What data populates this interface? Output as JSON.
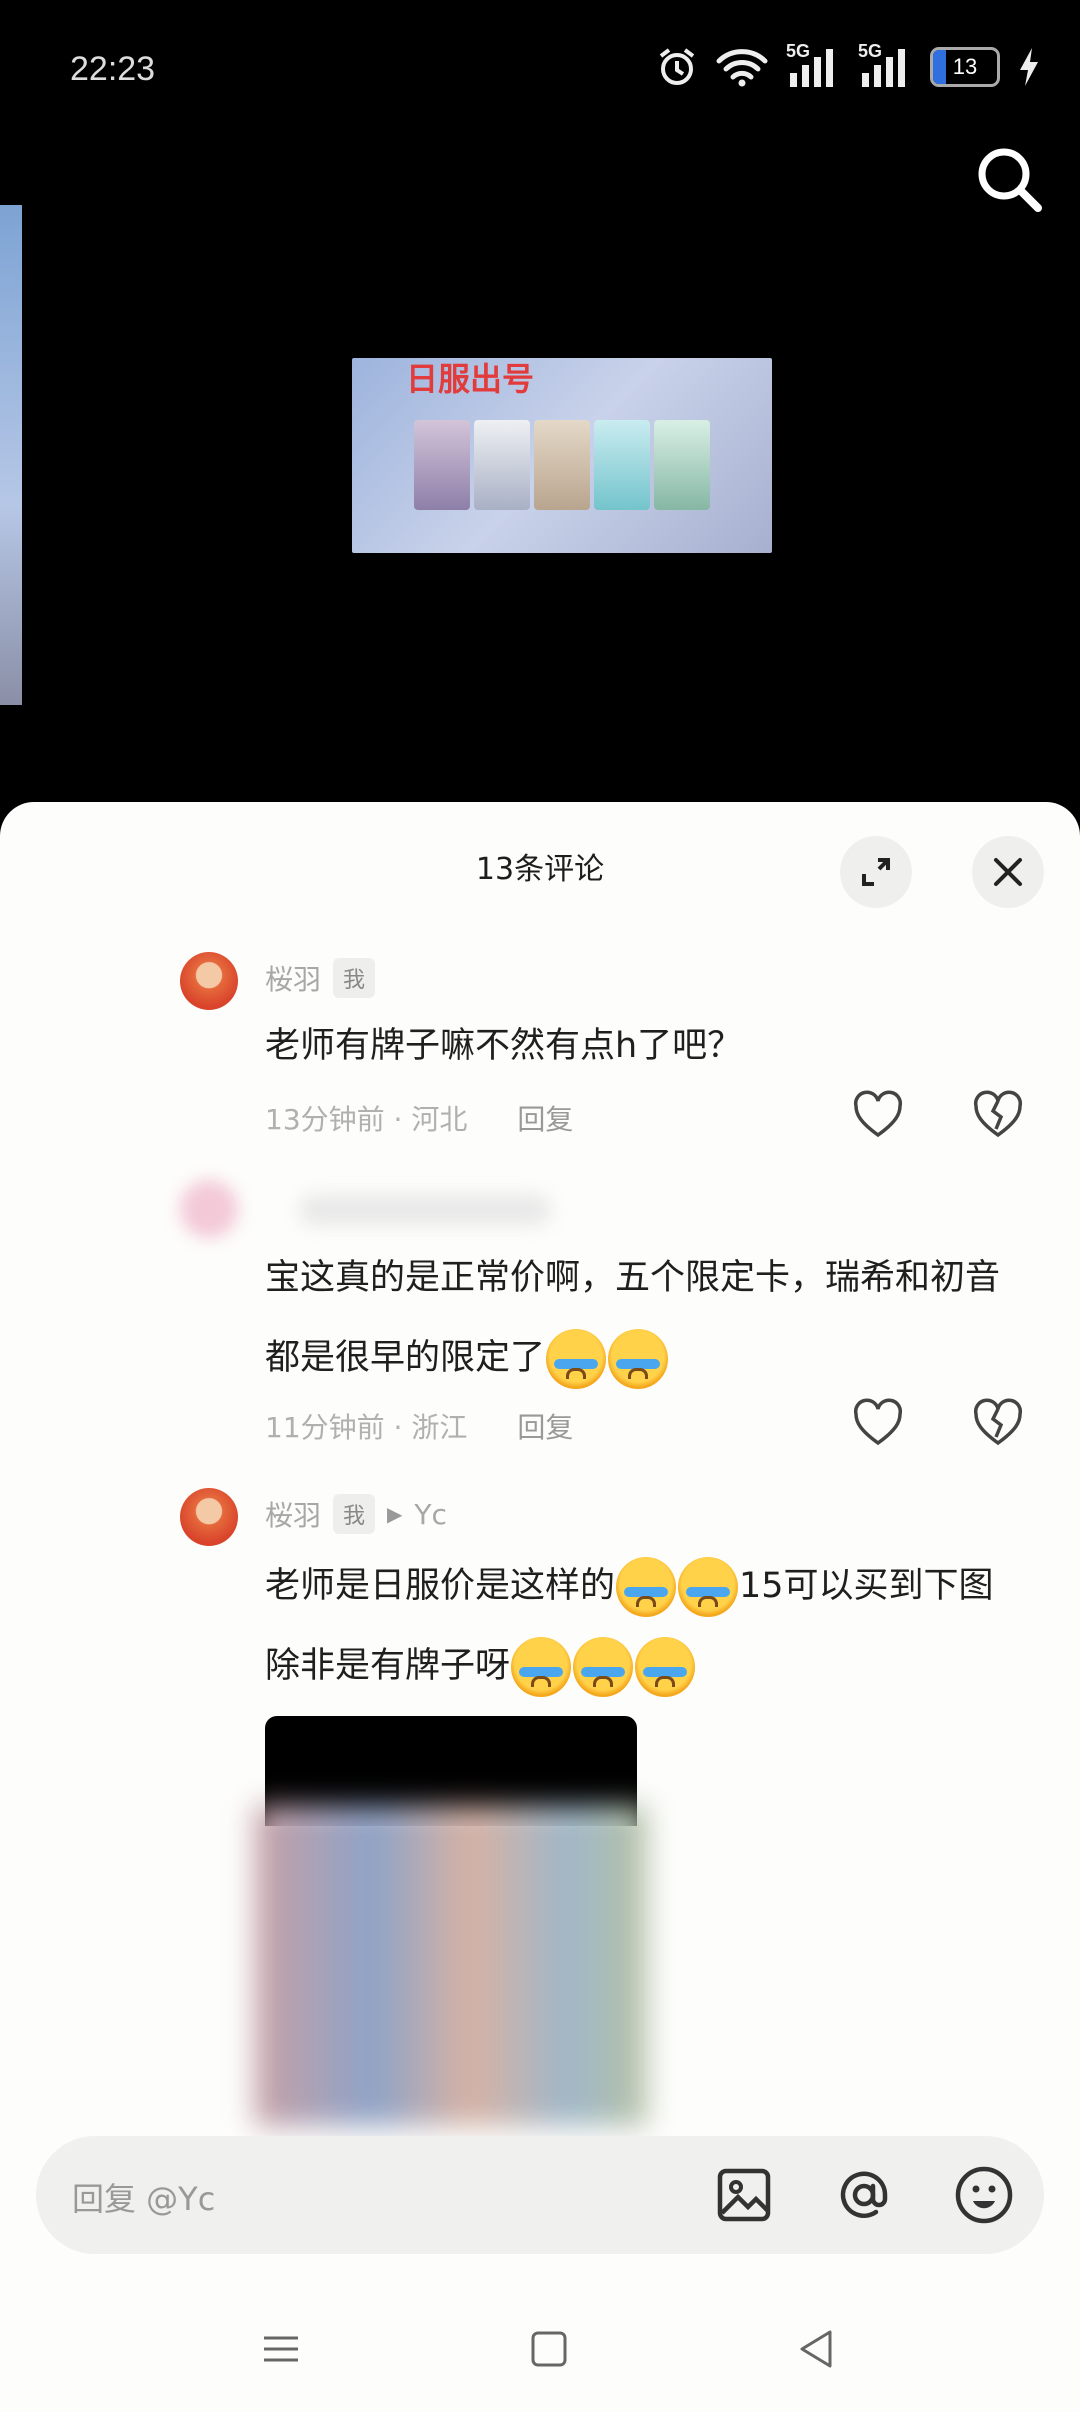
{
  "status_bar": {
    "time": "22:23",
    "battery": "13",
    "network_labels": [
      "5G",
      "5G"
    ]
  },
  "video": {
    "thumbnail_title": "日服出号"
  },
  "comments_panel": {
    "title": "13条评论",
    "comments": [
      {
        "author": "桜羽",
        "tag": "我",
        "text": "老师有牌子嘛不然有点h了吧？",
        "time_location": "13分钟前 · 河北",
        "reply_label": "回复"
      },
      {
        "author": "",
        "text_line1": "宝这真的是正常价啊，五个限定卡，瑞希和初音",
        "text_line2": "都是很早的限定了",
        "time_location": "11分钟前 · 浙江",
        "reply_label": "回复"
      },
      {
        "author": "桜羽",
        "tag": "我",
        "reply_to": "Yc",
        "text_line1a": "老师是日服价是这样的",
        "text_line1b": "15可以买到下图",
        "text_line2": "除非是有牌子呀"
      }
    ]
  },
  "input": {
    "placeholder": "回复 @Yc"
  },
  "colors": {
    "sheet_bg": "#fdfdfb",
    "accent_blue": "#2f6fe0",
    "thumbnail_title_red": "#e23b3b"
  }
}
